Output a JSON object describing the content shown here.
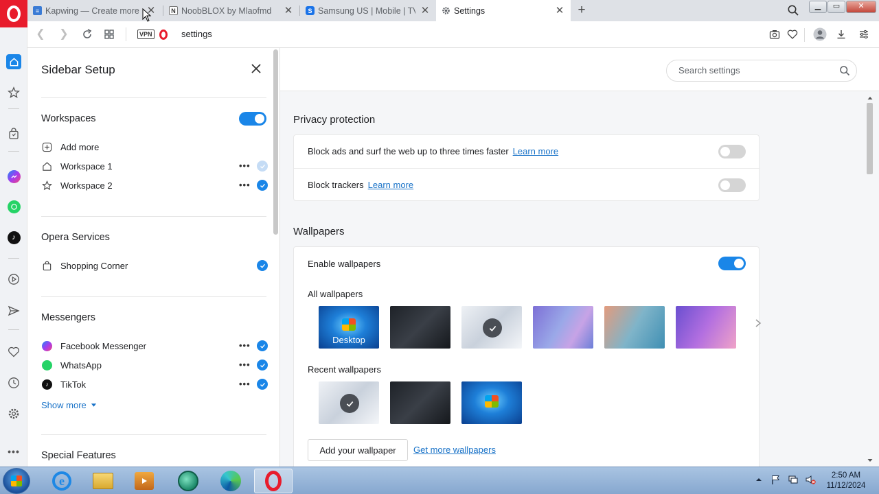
{
  "tabs": [
    {
      "title": "Kapwing — Create more c",
      "favicon": "kapwing-icon",
      "color": "#3a7bd5"
    },
    {
      "title": "NoobBLOX by Mlaofmd",
      "favicon": "notion-icon",
      "color": "#555555"
    },
    {
      "title": "Samsung US | Mobile | TV",
      "favicon": "samsung-icon",
      "color": "#1a73e8"
    },
    {
      "title": "Settings",
      "favicon": "gear-icon",
      "color": "#5f6368"
    }
  ],
  "address": {
    "vpn_label": "VPN",
    "url": "settings"
  },
  "sidebar_setup": {
    "title": "Sidebar Setup",
    "workspaces": {
      "title": "Workspaces",
      "enabled": true,
      "add_more": "Add more",
      "items": [
        {
          "label": "Workspace 1",
          "checked": true,
          "faint": true
        },
        {
          "label": "Workspace 2",
          "checked": true,
          "faint": false
        }
      ]
    },
    "opera_services": {
      "title": "Opera Services",
      "items": [
        {
          "label": "Shopping Corner",
          "checked": true
        }
      ]
    },
    "messengers": {
      "title": "Messengers",
      "items": [
        {
          "label": "Facebook Messenger",
          "checked": true
        },
        {
          "label": "WhatsApp",
          "checked": true
        },
        {
          "label": "TikTok",
          "checked": true
        }
      ],
      "show_more": "Show more"
    },
    "special_features": {
      "title": "Special Features"
    }
  },
  "settings": {
    "search_placeholder": "Search settings",
    "privacy": {
      "title": "Privacy protection",
      "block_ads": {
        "text": "Block ads and surf the web up to three times faster",
        "link": "Learn more",
        "enabled": false
      },
      "block_trackers": {
        "text": "Block trackers",
        "link": "Learn more",
        "enabled": false
      }
    },
    "wallpapers": {
      "title": "Wallpapers",
      "enable_label": "Enable wallpapers",
      "enabled": true,
      "all_label": "All wallpapers",
      "desktop_label": "Desktop",
      "recent_label": "Recent wallpapers",
      "add_button": "Add your wallpaper",
      "get_more_link": "Get more wallpapers"
    }
  },
  "taskbar": {
    "time": "2:50 AM",
    "date": "11/12/2024"
  },
  "colors": {
    "accent": "#1a86e8",
    "opera_red": "#e81c2c",
    "link": "#1a73c8"
  }
}
